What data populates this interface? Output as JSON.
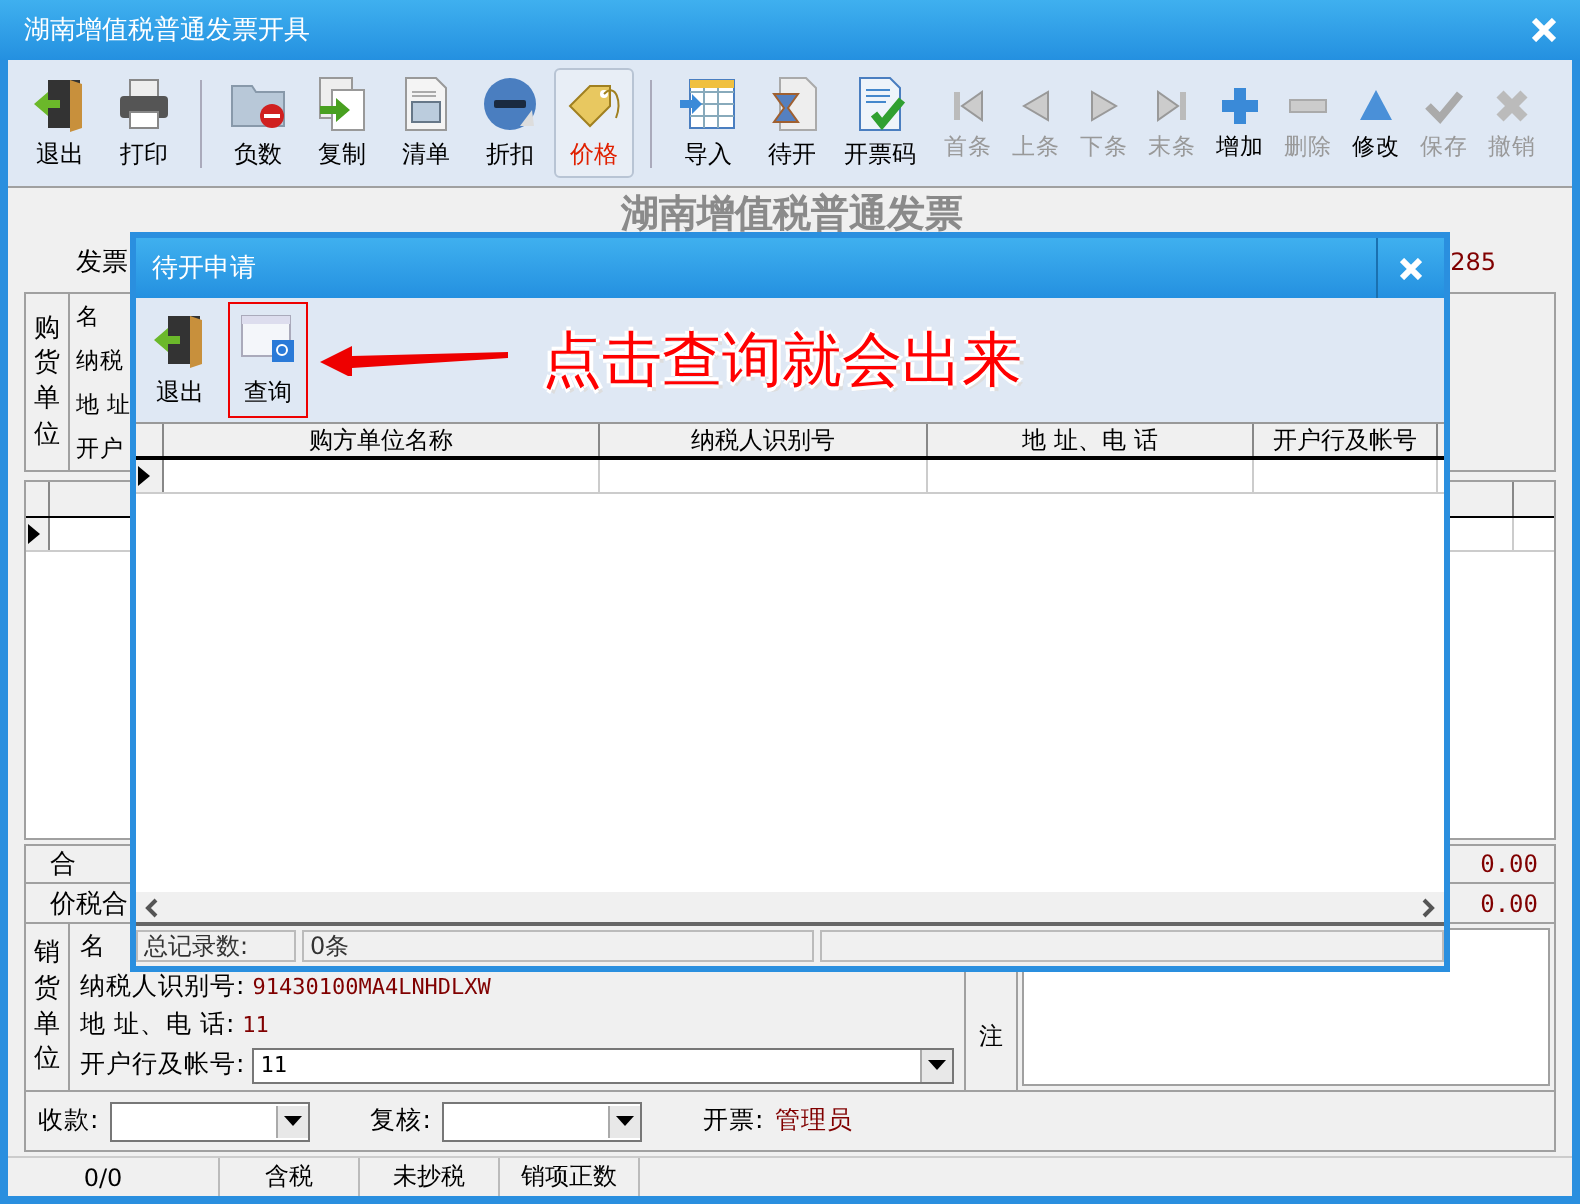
{
  "window": {
    "title": "湖南增值税普通发票开具"
  },
  "toolbar": {
    "groups": [
      [
        {
          "label": "退出",
          "selected": false
        },
        {
          "label": "打印",
          "selected": false
        }
      ],
      [
        {
          "label": "负数",
          "selected": false
        },
        {
          "label": "复制",
          "selected": false
        },
        {
          "label": "清单",
          "selected": false
        },
        {
          "label": "折扣",
          "selected": false
        },
        {
          "label": "价格",
          "selected": true
        }
      ],
      [
        {
          "label": "导入",
          "selected": false
        },
        {
          "label": "待开",
          "selected": false
        },
        {
          "label": "开票码",
          "selected": false
        }
      ]
    ],
    "nav": [
      {
        "label": "首条",
        "disabled": true
      },
      {
        "label": "上条",
        "disabled": true
      },
      {
        "label": "下条",
        "disabled": true
      },
      {
        "label": "末条",
        "disabled": true
      },
      {
        "label": "增加",
        "disabled": false
      },
      {
        "label": "删除",
        "disabled": true
      },
      {
        "label": "修改",
        "disabled": false
      },
      {
        "label": "保存",
        "disabled": true
      },
      {
        "label": "撤销",
        "disabled": true
      }
    ]
  },
  "invoice": {
    "title": "湖南增值税普通发票",
    "type_label": "发票",
    "number": "285"
  },
  "buyer": {
    "heading": "购货单位",
    "labels": [
      "名",
      "纳税",
      "地 址",
      "开户"
    ]
  },
  "totals": [
    {
      "label": "合",
      "amount": "0.00"
    },
    {
      "label": "价税合",
      "amount": "0.00"
    }
  ],
  "seller": {
    "heading": "销货单位",
    "fields": [
      {
        "kind": "text",
        "label": "名"
      },
      {
        "kind": "text",
        "label": "纳税人识别号:",
        "value": "91430100MA4LNHDLXW"
      },
      {
        "kind": "text",
        "label": "地 址、电 话:",
        "value": "11"
      },
      {
        "kind": "input",
        "label": "开户行及帐号:",
        "value": "11"
      }
    ]
  },
  "remarks": {
    "label": "注"
  },
  "signers": {
    "collector": {
      "label": "收款:"
    },
    "reviewer": {
      "label": "复核:"
    },
    "issuer": {
      "label": "开票:",
      "value": "管理员"
    }
  },
  "status_bar": [
    "0/0",
    "含税",
    "未抄税",
    "销项正数"
  ],
  "dialog": {
    "title": "待开申请",
    "toolbar": [
      {
        "label": "退出",
        "selected": false
      },
      {
        "label": "查询",
        "selected": true
      }
    ],
    "annotation": "点击查询就会出来",
    "columns": [
      "购方单位名称",
      "纳税人识别号",
      "地 址、电 话",
      "开户行及帐号"
    ],
    "status": {
      "label": "总记录数:",
      "count": "0条"
    }
  }
}
